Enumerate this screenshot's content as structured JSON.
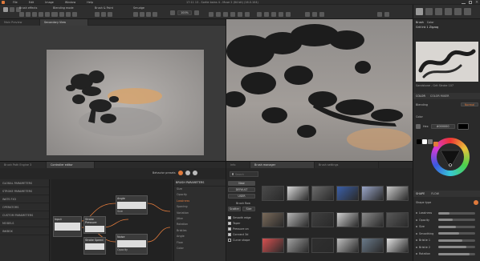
{
  "menu": {
    "items": [
      "File",
      "Edit",
      "Image",
      "Window",
      "Help"
    ],
    "title": "17:11 13 - Sortie bains 4 - Muse 2 (64 bit) (16.0.104)"
  },
  "toolbar": {
    "quick_labels": [
      "Brush effects",
      "Blending mode",
      "Brush & Paint",
      "Smudge"
    ],
    "zoom_value": "100%"
  },
  "left_view": {
    "tabs": [
      "Main Preview",
      "Secondary View"
    ]
  },
  "right_view": {},
  "right_panel": {
    "tabs": [
      "Brush",
      "Color"
    ],
    "brush_name": "Grit Ink 1 Zigzag",
    "brush_info": "Sandstone - Grit Stroke 107",
    "color_tabs": [
      "COLOR",
      "COLOR MIXER"
    ],
    "blending_label": "Blending",
    "blending_value": "Normal",
    "color_label": "Color",
    "hex_label": "Hex",
    "hex_value": "#000000",
    "swatch_colors": [
      "#000000",
      "#ffffff"
    ],
    "prop_tabs": [
      "SHAPE",
      "FLOW"
    ],
    "shape_section": "Shape type",
    "props": [
      "Lossiness",
      "Opacity",
      "Size",
      "Smoothing",
      "Bristle 1",
      "Bristle 2",
      "Rotation"
    ]
  },
  "controller": {
    "tabs": [
      "Brush Path Engine 3",
      "Controller editor"
    ],
    "behavior_label": "Behavior presets",
    "categories": [
      "GLOBAL PARAMETERS",
      "STROKE PARAMETERS",
      "WATS FX3",
      "OPERATORS",
      "CUSTOM PARAMETERS",
      "MODELS",
      "INKBOX"
    ],
    "node_labels": [
      "Input",
      "Stroke Pressure",
      "Stroke Speed",
      "Angle",
      "Noise",
      "Noise 2"
    ],
    "node_subs": [
      "Size",
      "Opacity",
      "Spacing",
      "Jitter",
      "Tilt",
      "Speed"
    ],
    "params_title": "BRUSH PARAMETERS",
    "params": [
      "Size",
      "Opacity",
      "Lossiness",
      "Spacing",
      "Variation",
      "Jitter",
      "Rotation",
      "Bristles",
      "Angle",
      "Flow",
      "Color"
    ]
  },
  "brush_manager": {
    "tabs": [
      "Info",
      "Brush manager",
      "Brush settings"
    ],
    "search_placeholder": "Search",
    "side_buttons": [
      "New",
      "DEFAULT",
      "USER",
      "Zoom"
    ],
    "side_labels": [
      "Brush flow",
      "Scatter",
      "Size",
      "Mode"
    ],
    "checkboxes": [
      "Smooth edge",
      "Taper",
      "Pressure on",
      "Connect 3d",
      "Curve shape"
    ]
  },
  "colors": {
    "accent": "#e07a3c",
    "panel": "#2b2b2b",
    "panel_dark": "#1f1f1f",
    "sky": "#8e8b8a",
    "cloud": "#d8a06a"
  }
}
